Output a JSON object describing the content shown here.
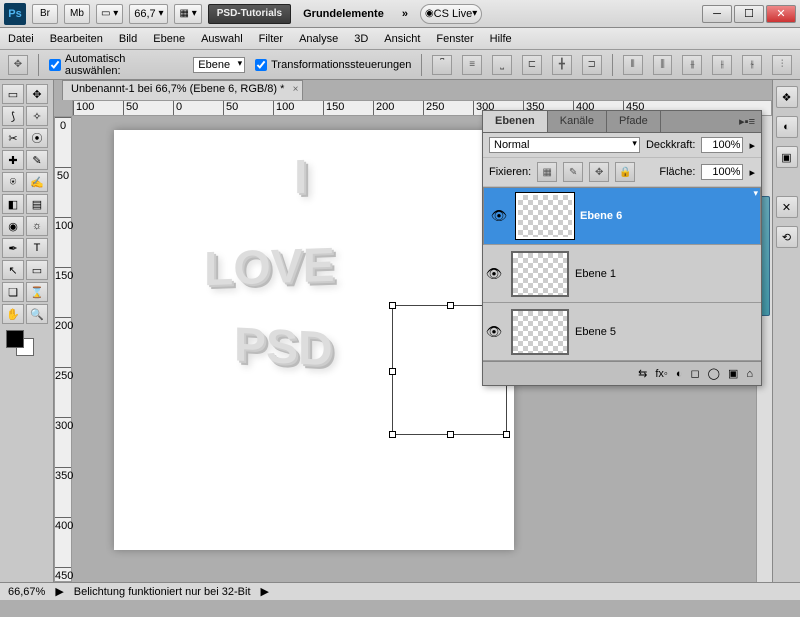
{
  "titlebar": {
    "br": "Br",
    "mb": "Mb",
    "zoom_pct": "66,7",
    "screen": "▭ ▾",
    "grid": "▦ ▾",
    "tutorial": "PSD-Tutorials",
    "doc": "Grundelemente",
    "more": "»",
    "cslive": "CS Live"
  },
  "menu": [
    "Datei",
    "Bearbeiten",
    "Bild",
    "Ebene",
    "Auswahl",
    "Filter",
    "Analyse",
    "3D",
    "Ansicht",
    "Fenster",
    "Hilfe"
  ],
  "options": {
    "auto_select": "Automatisch auswählen:",
    "auto_target": "Ebene",
    "transform_controls": "Transformationssteuerungen"
  },
  "doc_tab": "Unbenannt-1 bei 66,7% (Ebene 6, RGB/8) *",
  "ruler_h": [
    "100",
    "50",
    "0",
    "50",
    "100",
    "150",
    "200",
    "250",
    "300",
    "350",
    "400",
    "450"
  ],
  "ruler_v": [
    "0",
    "50",
    "100",
    "150",
    "200",
    "250",
    "300",
    "350",
    "400",
    "450"
  ],
  "canvas_text": {
    "l1": "I",
    "l2": "LOVE",
    "l3": "PSD"
  },
  "layers_panel": {
    "tabs": [
      "Ebenen",
      "Kanäle",
      "Pfade"
    ],
    "blend": "Normal",
    "opacity_label": "Deckkraft:",
    "opacity": "100%",
    "lock_label": "Fixieren:",
    "fill_label": "Fläche:",
    "fill": "100%",
    "layers": [
      {
        "name": "Ebene 6",
        "selected": true
      },
      {
        "name": "Ebene 1",
        "selected": false
      },
      {
        "name": "Ebene 5",
        "selected": false
      }
    ],
    "footer_icons": [
      "⇆",
      "fx◦",
      "◐",
      "◻",
      "◯",
      "▣",
      "⌂"
    ]
  },
  "status": {
    "zoom": "66,67%",
    "msg": "Belichtung funktioniert nur bei 32-Bit"
  }
}
